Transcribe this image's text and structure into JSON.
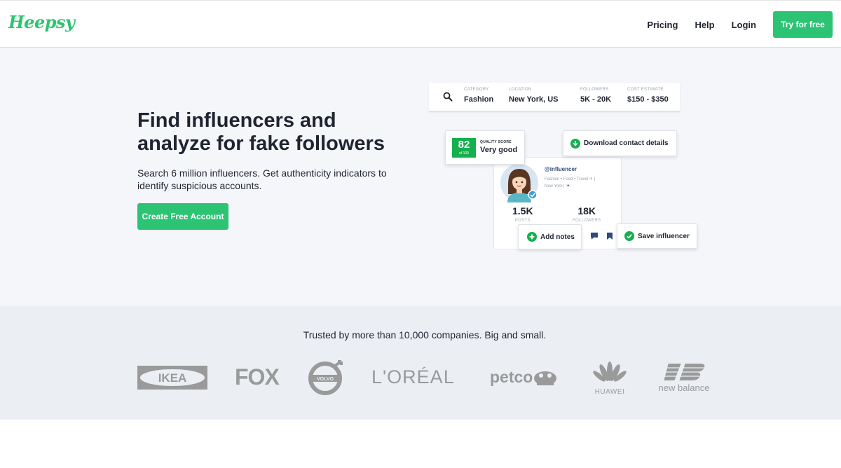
{
  "header": {
    "logo": "Heepsy",
    "nav": [
      "Pricing",
      "Help",
      "Login"
    ],
    "try_label": "Try for free"
  },
  "hero": {
    "title": "Find influencers and analyze for fake followers",
    "subtitle": "Search 6 million influencers. Get authenticity indicators to identify suspicious accounts.",
    "cta_label": "Create Free Account"
  },
  "search": {
    "fields": [
      {
        "label": "CATEGORY",
        "value": "Fashion"
      },
      {
        "label": "LOCATION",
        "value": "New York, US"
      },
      {
        "label": "FOLLOWERS",
        "value": "5K - 20K"
      },
      {
        "label": "COST ESTIMATE",
        "value": "$150 - $350"
      }
    ]
  },
  "quality": {
    "score": "82",
    "score_of": "of 100",
    "label": "QUALITY SCORE",
    "value": "Very good"
  },
  "profile": {
    "handle": "@influencer",
    "bio_line1": "Fashion • Food • Travel ✈ |",
    "bio_line2": "New York | 💌",
    "posts_value": "1.5K",
    "posts_label": "POSTS",
    "followers_value": "18K",
    "followers_label": "FOLLOWERS"
  },
  "actions": {
    "download": "Download contact details",
    "notes": "Add notes",
    "save": "Save influencer"
  },
  "trusted": {
    "text": "Trusted by more than 10,000 companies. Big and small.",
    "brands": [
      "IKEA",
      "FOX",
      "VOLVO",
      "L'ORÉAL",
      "petco",
      "HUAWEI",
      "new balance"
    ]
  },
  "colors": {
    "brand_green": "#2cc474",
    "score_green": "#14b04e",
    "navy": "#2f4a7a"
  }
}
